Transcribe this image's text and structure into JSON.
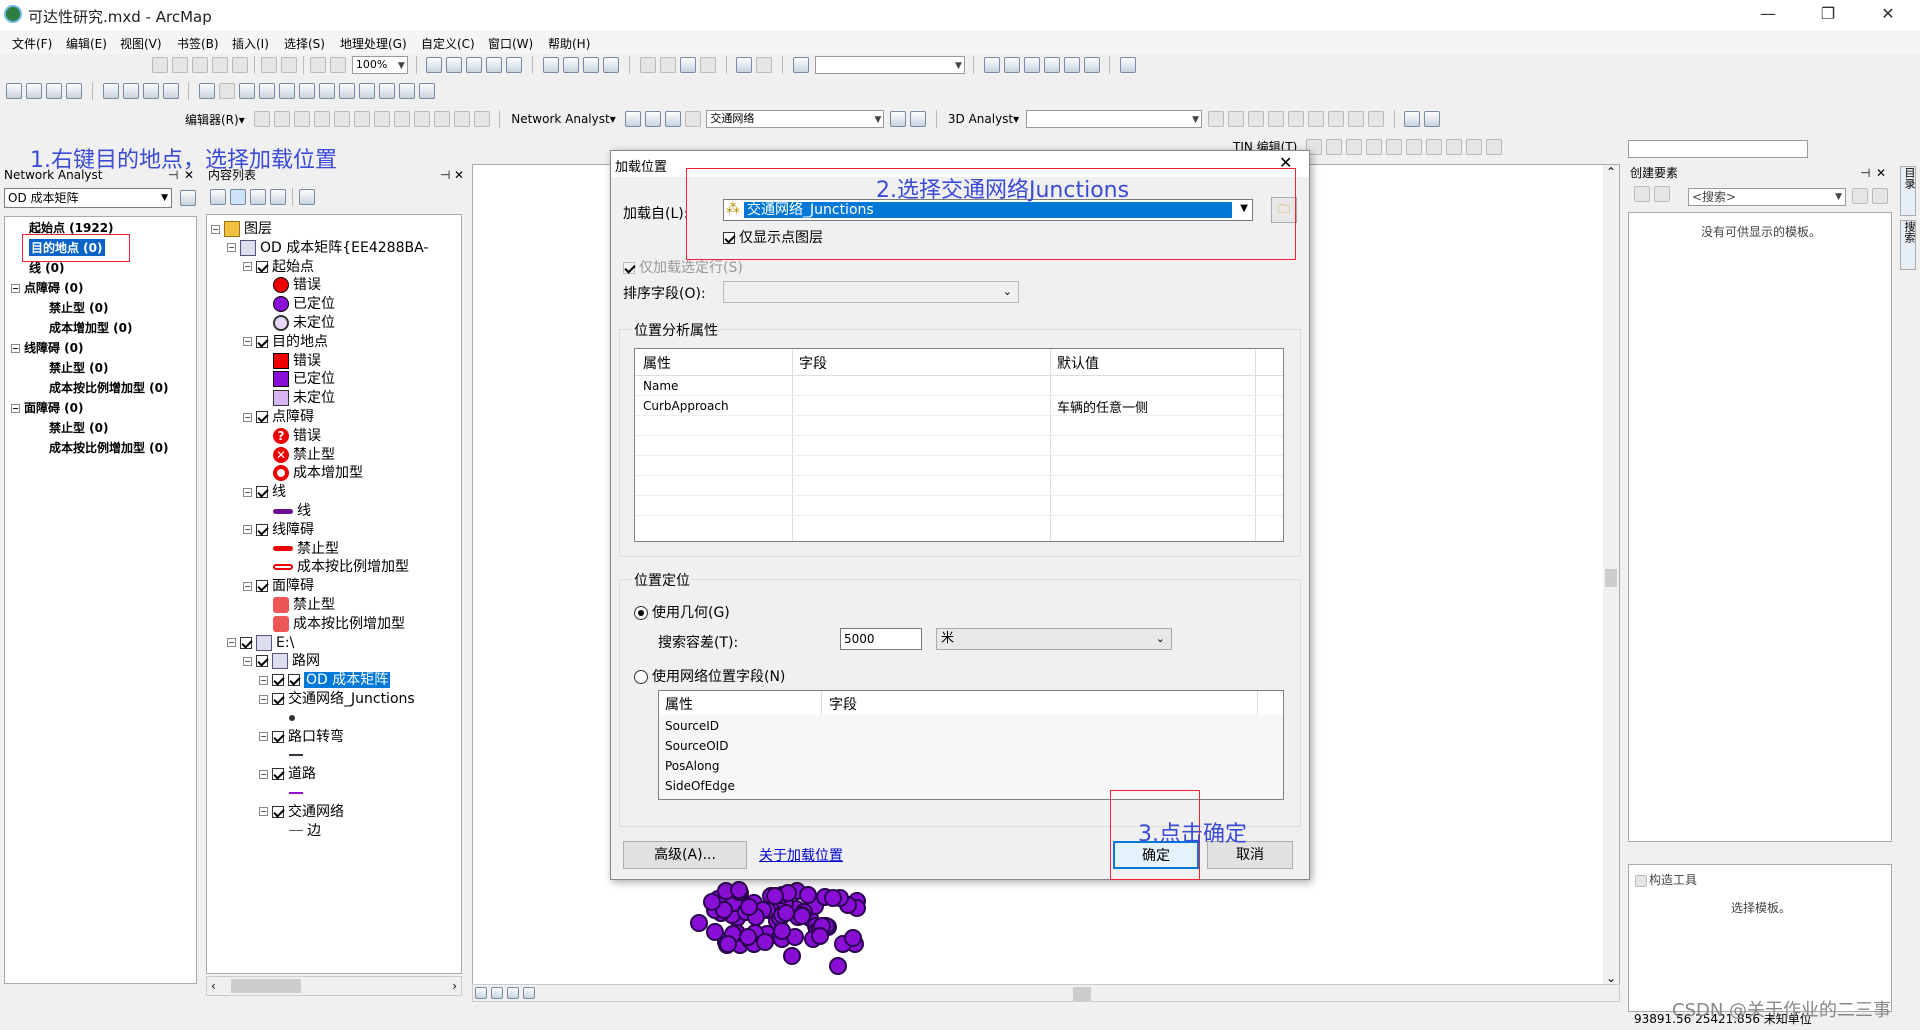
{
  "window": {
    "title": "可达性研究.mxd - ArcMap"
  },
  "menu": [
    "文件(F)",
    "编辑(E)",
    "视图(V)",
    "书签(B)",
    "插入(I)",
    "选择(S)",
    "地理处理(G)",
    "自定义(C)",
    "窗口(W)",
    "帮助(H)"
  ],
  "toolbar": {
    "zoom_value": "100%",
    "editor_label": "编辑器(R)▾",
    "network_analyst_label": "Network Analyst▾",
    "network_dataset": "交通网络",
    "analyst_3d_label": "3D Analyst▾",
    "tin_label": "TIN 编辑(T)"
  },
  "network_analyst_window": {
    "title": "Network Analyst",
    "layer_select": "OD 成本矩阵",
    "items": [
      {
        "label": "起始点 (1922)",
        "level": 0
      },
      {
        "label": "目的地点 (0)",
        "level": 0,
        "selected": true
      },
      {
        "label": "线 (0)",
        "level": 0
      },
      {
        "label": "点障碍 (0)",
        "level": 0
      },
      {
        "label": "禁止型 (0)",
        "level": 1
      },
      {
        "label": "成本增加型 (0)",
        "level": 1
      },
      {
        "label": "线障碍 (0)",
        "level": 0
      },
      {
        "label": "禁止型 (0)",
        "level": 1
      },
      {
        "label": "成本按比例增加型 (0)",
        "level": 1
      },
      {
        "label": "面障碍 (0)",
        "level": 0
      },
      {
        "label": "禁止型 (0)",
        "level": 1
      },
      {
        "label": "成本按比例增加型 (0)",
        "level": 1
      }
    ]
  },
  "toc": {
    "title": "内容列表",
    "rows": [
      {
        "text": "图层",
        "indent": 0
      },
      {
        "text": "OD 成本矩阵{EE4288BA-",
        "indent": 1
      },
      {
        "text": "起始点",
        "indent": 2
      },
      {
        "text": "错误",
        "indent": 3
      },
      {
        "text": "已定位",
        "indent": 3
      },
      {
        "text": "未定位",
        "indent": 3
      },
      {
        "text": "目的地点",
        "indent": 2
      },
      {
        "text": "错误",
        "indent": 3
      },
      {
        "text": "已定位",
        "indent": 3
      },
      {
        "text": "未定位",
        "indent": 3
      },
      {
        "text": "点障碍",
        "indent": 2
      },
      {
        "text": "错误",
        "indent": 3
      },
      {
        "text": "禁止型",
        "indent": 3
      },
      {
        "text": "成本增加型",
        "indent": 3
      },
      {
        "text": "线",
        "indent": 2
      },
      {
        "text": "线",
        "indent": 3
      },
      {
        "text": "线障碍",
        "indent": 2
      },
      {
        "text": "禁止型",
        "indent": 3
      },
      {
        "text": "成本按比例增加型",
        "indent": 3
      },
      {
        "text": "面障碍",
        "indent": 2
      },
      {
        "text": "禁止型",
        "indent": 3
      },
      {
        "text": "成本按比例增加型",
        "indent": 3
      },
      {
        "text": "E:\\",
        "indent": 1
      },
      {
        "text": "路网",
        "indent": 2
      },
      {
        "text": "OD 成本矩阵",
        "indent": 3
      },
      {
        "text": "交通网络_Junctions",
        "indent": 3
      },
      {
        "text": "",
        "indent": 4
      },
      {
        "text": "路口转弯",
        "indent": 3
      },
      {
        "text": "",
        "indent": 4
      },
      {
        "text": "道路",
        "indent": 3
      },
      {
        "text": "",
        "indent": 4
      },
      {
        "text": "交通网络",
        "indent": 3
      },
      {
        "text": "边",
        "indent": 4
      }
    ]
  },
  "annotations": {
    "step1": "1.右键目的地点，选择加载位置",
    "step2": "2.选择交通网络Junctions",
    "step3": "3.点击确定"
  },
  "dialog": {
    "title": "加载位置",
    "load_from_label": "加载自(L):",
    "load_from_value": "交通网络_Junctions",
    "only_points_label": "仅显示点图层",
    "load_selected_label": "仅加载选定行(S)",
    "sort_field_label": "排序字段(O):",
    "sort_field_value": "",
    "location_props_title": "位置分析属性",
    "props_headers": [
      "属性",
      "字段",
      "默认值"
    ],
    "props_rows": [
      [
        "Name",
        "",
        ""
      ],
      [
        "CurbApproach",
        "",
        "车辆的任意一侧"
      ]
    ],
    "location_position_title": "位置定位",
    "use_geometry_label": "使用几何(G)",
    "search_tolerance_label": "搜索容差(T):",
    "search_tolerance_value": "5000",
    "tolerance_unit": "米",
    "use_network_fields_label": "使用网络位置字段(N)",
    "net_headers": [
      "属性",
      "字段"
    ],
    "net_rows": [
      "SourceID",
      "SourceOID",
      "PosAlong",
      "SideOfEdge"
    ],
    "advanced_button": "高级(A)...",
    "about_link": "关于加载位置",
    "ok_button": "确定",
    "cancel_button": "取消"
  },
  "create_features": {
    "title": "创建要素",
    "search_placeholder": "<搜索>",
    "empty_text": "没有可供显示的模板。",
    "construct_title": "构造工具",
    "construct_text": "选择模板。"
  },
  "right_tabs": [
    "目录",
    "搜索"
  ],
  "status": {
    "coords": "93891.56  25421.856 未知单位"
  },
  "watermark": "CSDN @关于作业的二三事",
  "colors": {
    "accent": "#3b4bd6",
    "highlight": "#0078d7",
    "point_fill": "#8a0fd6",
    "annotation_box": "#e23"
  }
}
